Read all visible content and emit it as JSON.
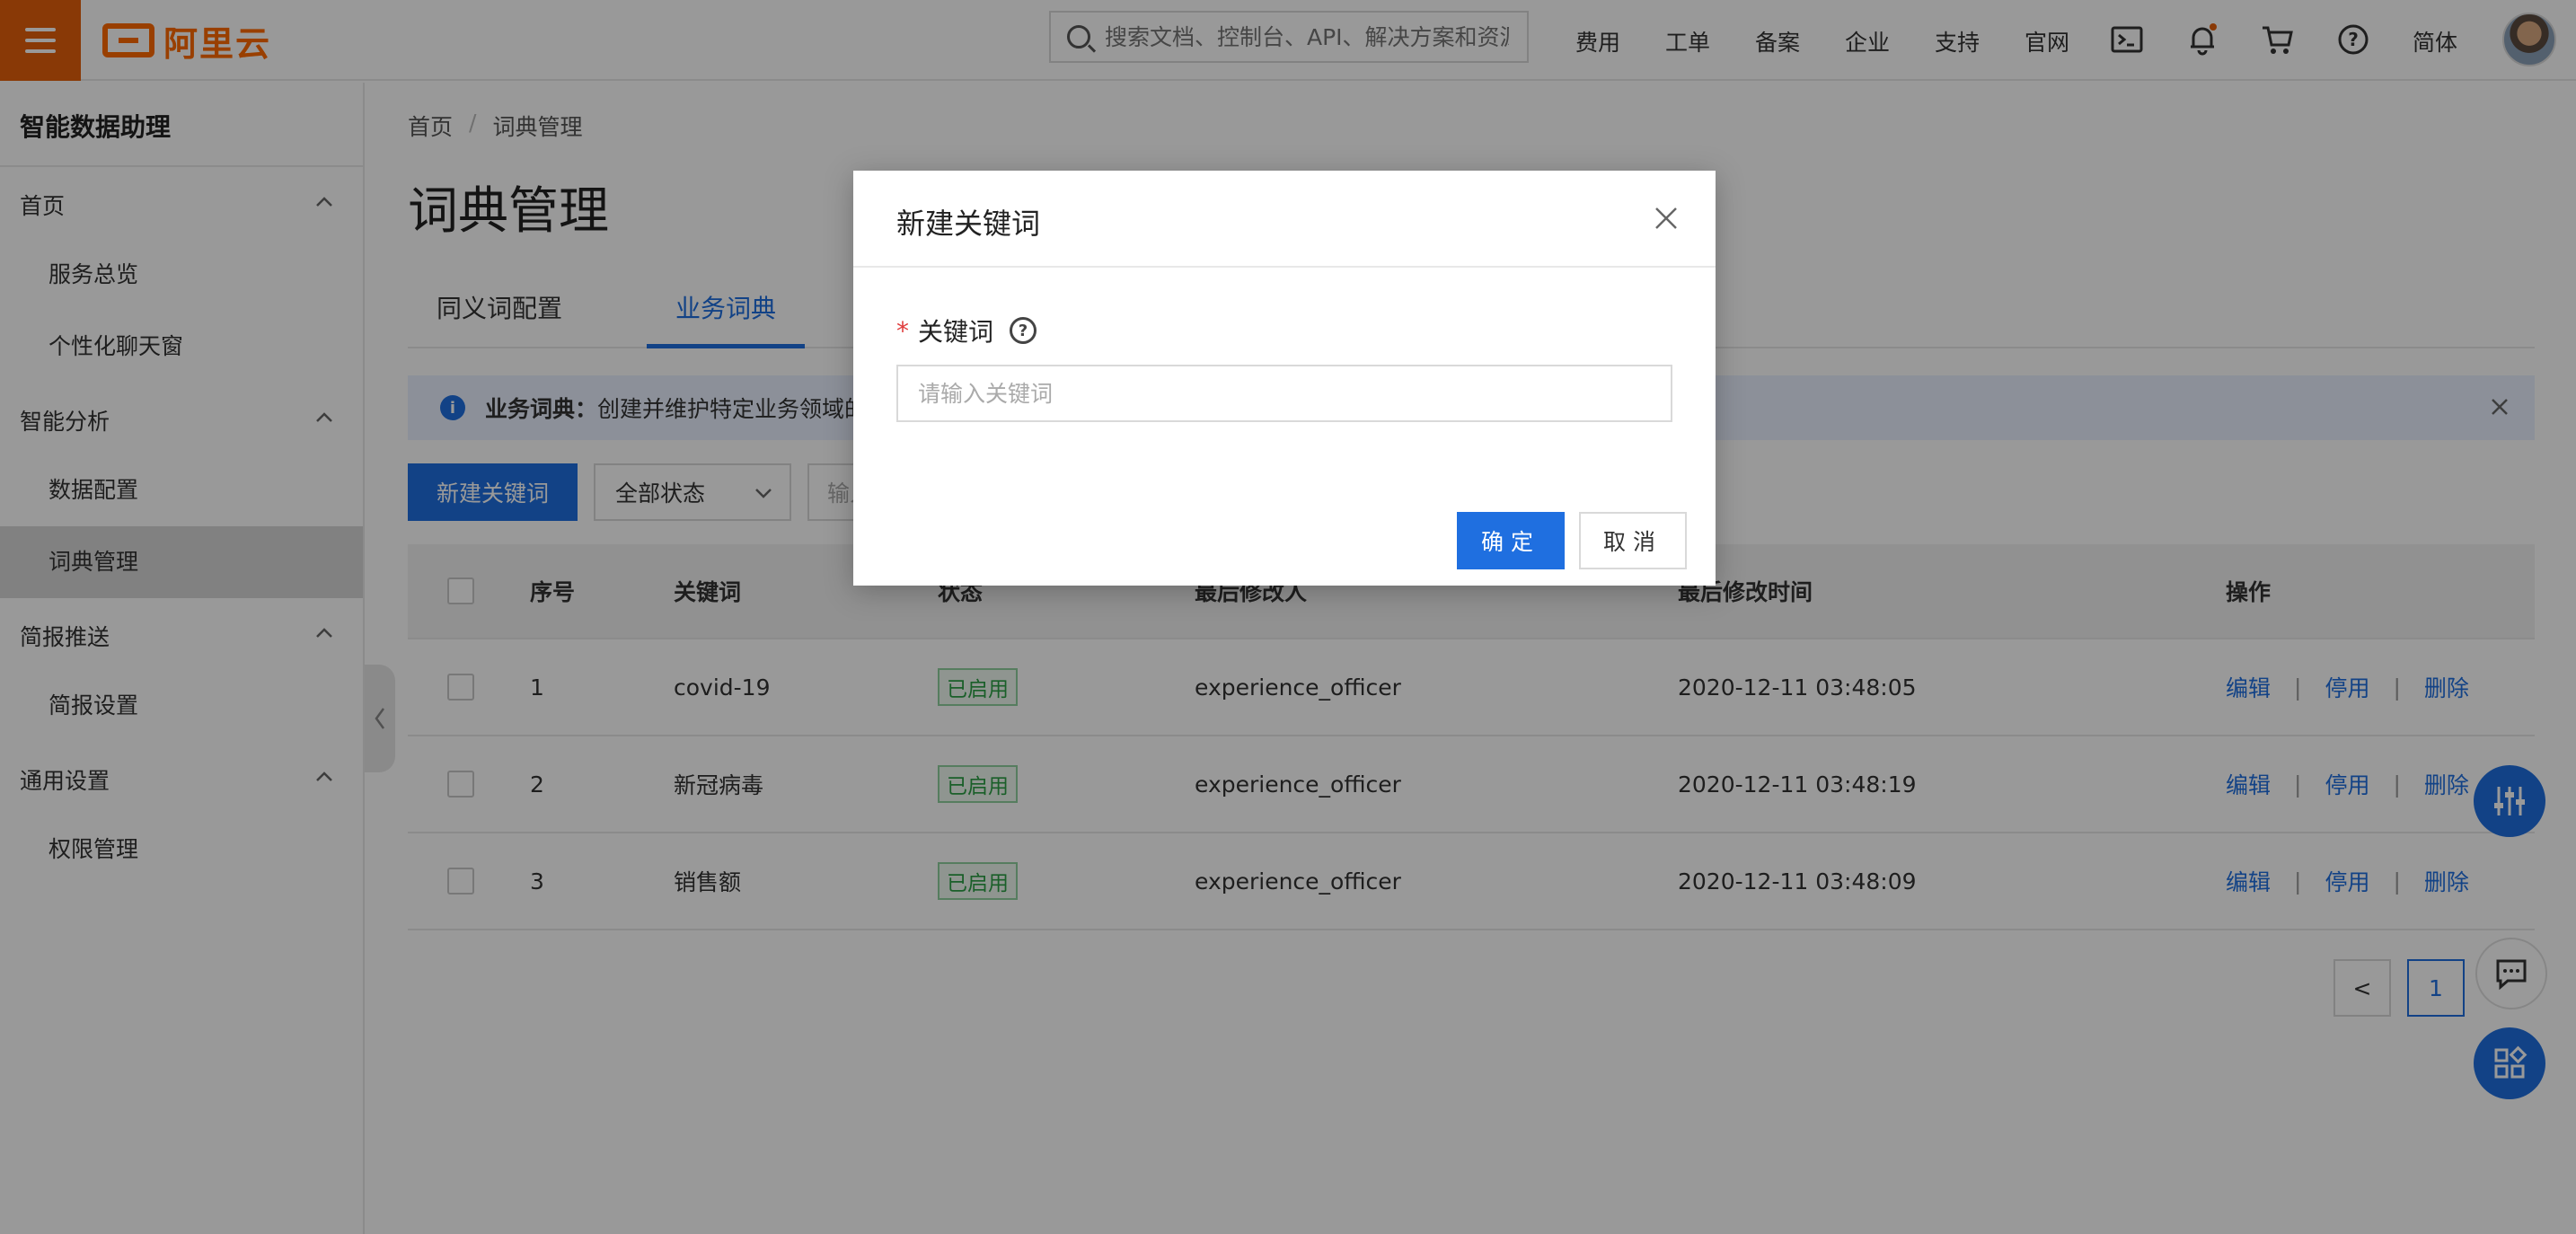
{
  "topbar": {
    "logo_text": "阿里云",
    "search_placeholder": "搜索文档、控制台、API、解决方案和资源",
    "nav": [
      "费用",
      "工单",
      "备案",
      "企业",
      "支持",
      "官网"
    ],
    "lang": "简体",
    "icons": [
      "terminal-icon",
      "bell-icon",
      "cart-icon",
      "help-icon"
    ]
  },
  "sidebar": {
    "title": "智能数据助理",
    "groups": [
      {
        "label": "首页",
        "items": [
          "服务总览",
          "个性化聊天窗"
        ]
      },
      {
        "label": "智能分析",
        "items": [
          "数据配置",
          "词典管理"
        ]
      },
      {
        "label": "简报推送",
        "items": [
          "简报设置"
        ]
      },
      {
        "label": "通用设置",
        "items": [
          "权限管理"
        ]
      }
    ],
    "active_item": "词典管理"
  },
  "main": {
    "breadcrumb": [
      "首页",
      "词典管理"
    ],
    "title": "词典管理",
    "tabs": [
      "同义词配置",
      "业务词典"
    ],
    "active_tab": "业务词典",
    "notice": {
      "label": "业务词典：",
      "text": "创建并维护特定业务领域的词"
    },
    "toolbar": {
      "new_button": "新建关键词",
      "status_select": "全部状态",
      "filter_placeholder": "输入"
    },
    "table": {
      "headers": [
        "序号",
        "关键词",
        "状态",
        "最后修改人",
        "最后修改时间",
        "操作"
      ],
      "rows": [
        {
          "no": "1",
          "keyword": "covid-19",
          "status": "已启用",
          "modifier": "experience_officer",
          "time": "2020-12-11 03:48:05"
        },
        {
          "no": "2",
          "keyword": "新冠病毒",
          "status": "已启用",
          "modifier": "experience_officer",
          "time": "2020-12-11 03:48:19"
        },
        {
          "no": "3",
          "keyword": "销售额",
          "status": "已启用",
          "modifier": "experience_officer",
          "time": "2020-12-11 03:48:09"
        }
      ],
      "actions": [
        "编辑",
        "停用",
        "删除"
      ]
    },
    "pagination": {
      "prev": "<",
      "current": "1"
    }
  },
  "modal": {
    "title": "新建关键词",
    "field_label": "关键词",
    "required_mark": "*",
    "input_placeholder": "请输入关键词",
    "input_value": "",
    "ok": "确定",
    "cancel": "取消"
  },
  "colors": {
    "brand": "#ff6a00",
    "primary": "#1f6fe0",
    "success": "#2c9f45"
  }
}
